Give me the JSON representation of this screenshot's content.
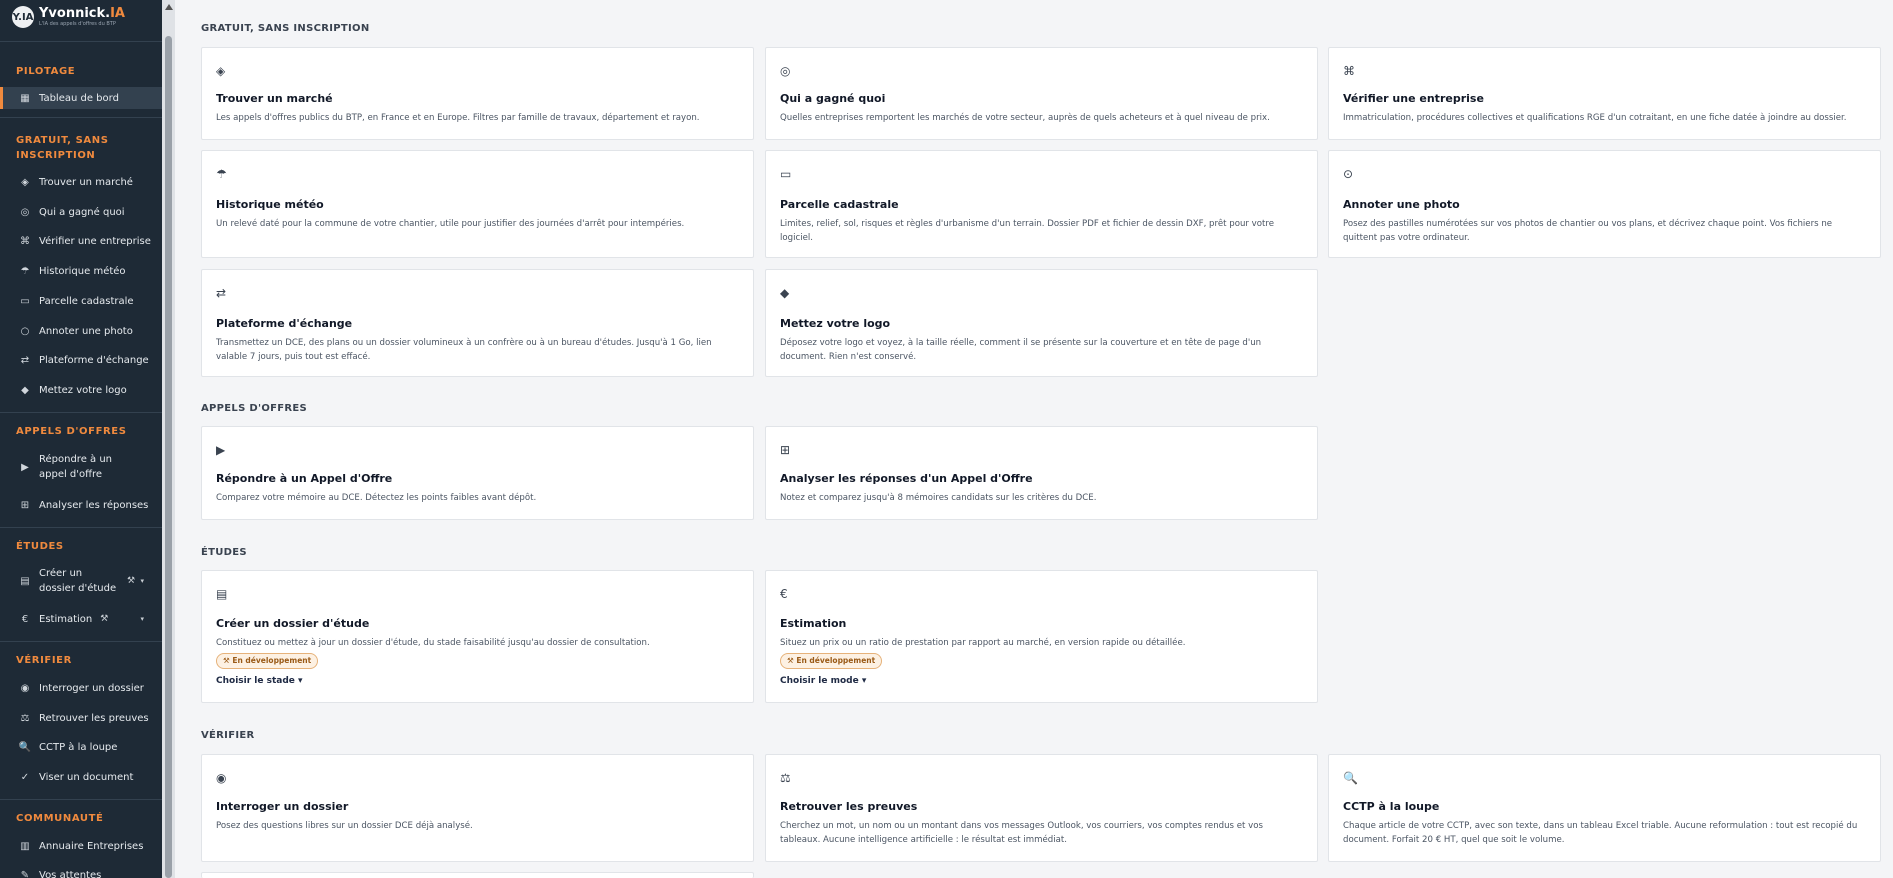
{
  "app": {
    "name_main": "Yvonnick.",
    "name_accent": "IA",
    "tagline": "L'IA des appels d'offres du BTP",
    "badge": "Y.IA"
  },
  "sidebar": {
    "sections": [
      {
        "title": "PILOTAGE",
        "items": [
          {
            "label": "Tableau de bord",
            "icon": "▦",
            "active": true
          }
        ]
      },
      {
        "title": "GRATUIT, SANS INSCRIPTION",
        "items": [
          {
            "label": "Trouver un marché",
            "icon": "◈"
          },
          {
            "label": "Qui a gagné quoi",
            "icon": "◎"
          },
          {
            "label": "Vérifier une entreprise",
            "icon": "⌘"
          },
          {
            "label": "Historique météo",
            "icon": "☂"
          },
          {
            "label": "Parcelle cadastrale",
            "icon": "▭"
          },
          {
            "label": "Annoter une photo",
            "icon": "○"
          },
          {
            "label": "Plateforme d'échange",
            "icon": "⇄"
          },
          {
            "label": "Mettez votre logo",
            "icon": "◆"
          }
        ]
      },
      {
        "title": "APPELS D'OFFRES",
        "items": [
          {
            "label": "Répondre à un appel d'offre",
            "icon": "▶"
          },
          {
            "label": "Analyser les réponses",
            "icon": "⊞"
          }
        ]
      },
      {
        "title": "ÉTUDES",
        "items": [
          {
            "label": "Créer un dossier d'étude",
            "icon": "▤",
            "tool": "⚒",
            "caret": "▾"
          },
          {
            "label": "Estimation",
            "icon": "€",
            "tool": "⚒",
            "caret": "▾"
          }
        ]
      },
      {
        "title": "VÉRIFIER",
        "items": [
          {
            "label": "Interroger un dossier",
            "icon": "◉"
          },
          {
            "label": "Retrouver les preuves",
            "icon": "⚖"
          },
          {
            "label": "CCTP à la loupe",
            "icon": "🔍"
          },
          {
            "label": "Viser un document",
            "icon": "✓"
          }
        ]
      },
      {
        "title": "COMMUNAUTÉ",
        "items": [
          {
            "label": "Annuaire Entreprises",
            "icon": "▥"
          },
          {
            "label": "Vos attentes",
            "icon": "✎"
          }
        ]
      }
    ]
  },
  "main": {
    "sections": [
      {
        "title": "GRATUIT, SANS INSCRIPTION",
        "cards": [
          {
            "icon": "◈",
            "title": "Trouver un marché",
            "desc": "Les appels d'offres publics du BTP, en France et en Europe. Filtres par famille de travaux, département et rayon."
          },
          {
            "icon": "◎",
            "title": "Qui a gagné quoi",
            "desc": "Quelles entreprises remportent les marchés de votre secteur, auprès de quels acheteurs et à quel niveau de prix."
          },
          {
            "icon": "⌘",
            "title": "Vérifier une entreprise",
            "desc": "Immatriculation, procédures collectives et qualifications RGE d'un cotraitant, en une fiche datée à joindre au dossier."
          },
          {
            "icon": "☂",
            "title": "Historique météo",
            "desc": "Un relevé daté pour la commune de votre chantier, utile pour justifier des journées d'arrêt pour intempéries."
          },
          {
            "icon": "▭",
            "title": "Parcelle cadastrale",
            "desc": "Limites, relief, sol, risques et règles d'urbanisme d'un terrain. Dossier PDF et fichier de dessin DXF, prêt pour votre logiciel."
          },
          {
            "icon": "⊙",
            "title": "Annoter une photo",
            "desc": "Posez des pastilles numérotées sur vos photos de chantier ou vos plans, et décrivez chaque point. Vos fichiers ne quittent pas votre ordinateur."
          },
          {
            "icon": "⇄",
            "title": "Plateforme d'échange",
            "desc": "Transmettez un DCE, des plans ou un dossier volumineux à un confrère ou à un bureau d'études. Jusqu'à 1 Go, lien valable 7 jours, puis tout est effacé."
          },
          {
            "icon": "◆",
            "title": "Mettez votre logo",
            "desc": "Déposez votre logo et voyez, à la taille réelle, comment il se présente sur la couverture et en tête de page d'un document. Rien n'est conservé."
          }
        ]
      },
      {
        "title": "APPELS D'OFFRES",
        "cards": [
          {
            "icon": "▶",
            "title": "Répondre à un Appel d'Offre",
            "desc": "Comparez votre mémoire au DCE. Détectez les points faibles avant dépôt."
          },
          {
            "icon": "⊞",
            "title": "Analyser les réponses d'un Appel d'Offre",
            "desc": "Notez et comparez jusqu'à 8 mémoires candidats sur les critères du DCE."
          }
        ]
      },
      {
        "title": "ÉTUDES",
        "cards": [
          {
            "icon": "▤",
            "title": "Créer un dossier d'étude",
            "desc": "Constituez ou mettez à jour un dossier d'étude, du stade faisabilité jusqu'au dossier de consultation.",
            "badge": "⚒ En développement",
            "link": "Choisir le stade ▾"
          },
          {
            "icon": "€",
            "title": "Estimation",
            "desc": "Situez un prix ou un ratio de prestation par rapport au marché, en version rapide ou détaillée.",
            "badge": "⚒ En développement",
            "link": "Choisir le mode ▾"
          }
        ]
      },
      {
        "title": "VÉRIFIER",
        "cards": [
          {
            "icon": "◉",
            "title": "Interroger un dossier",
            "desc": "Posez des questions libres sur un dossier DCE déjà analysé."
          },
          {
            "icon": "⚖",
            "title": "Retrouver les preuves",
            "desc": "Cherchez un mot, un nom ou un montant dans vos messages Outlook, vos courriers, vos comptes rendus et vos tableaux. Aucune intelligence artificielle : le résultat est immédiat."
          },
          {
            "icon": "🔍",
            "title": "CCTP à la loupe",
            "desc": "Chaque article de votre CCTP, avec son texte, dans un tableau Excel triable. Aucune reformulation : tout est recopié du document. Forfait 20 € HT, quel que soit le volume."
          }
        ]
      }
    ]
  }
}
